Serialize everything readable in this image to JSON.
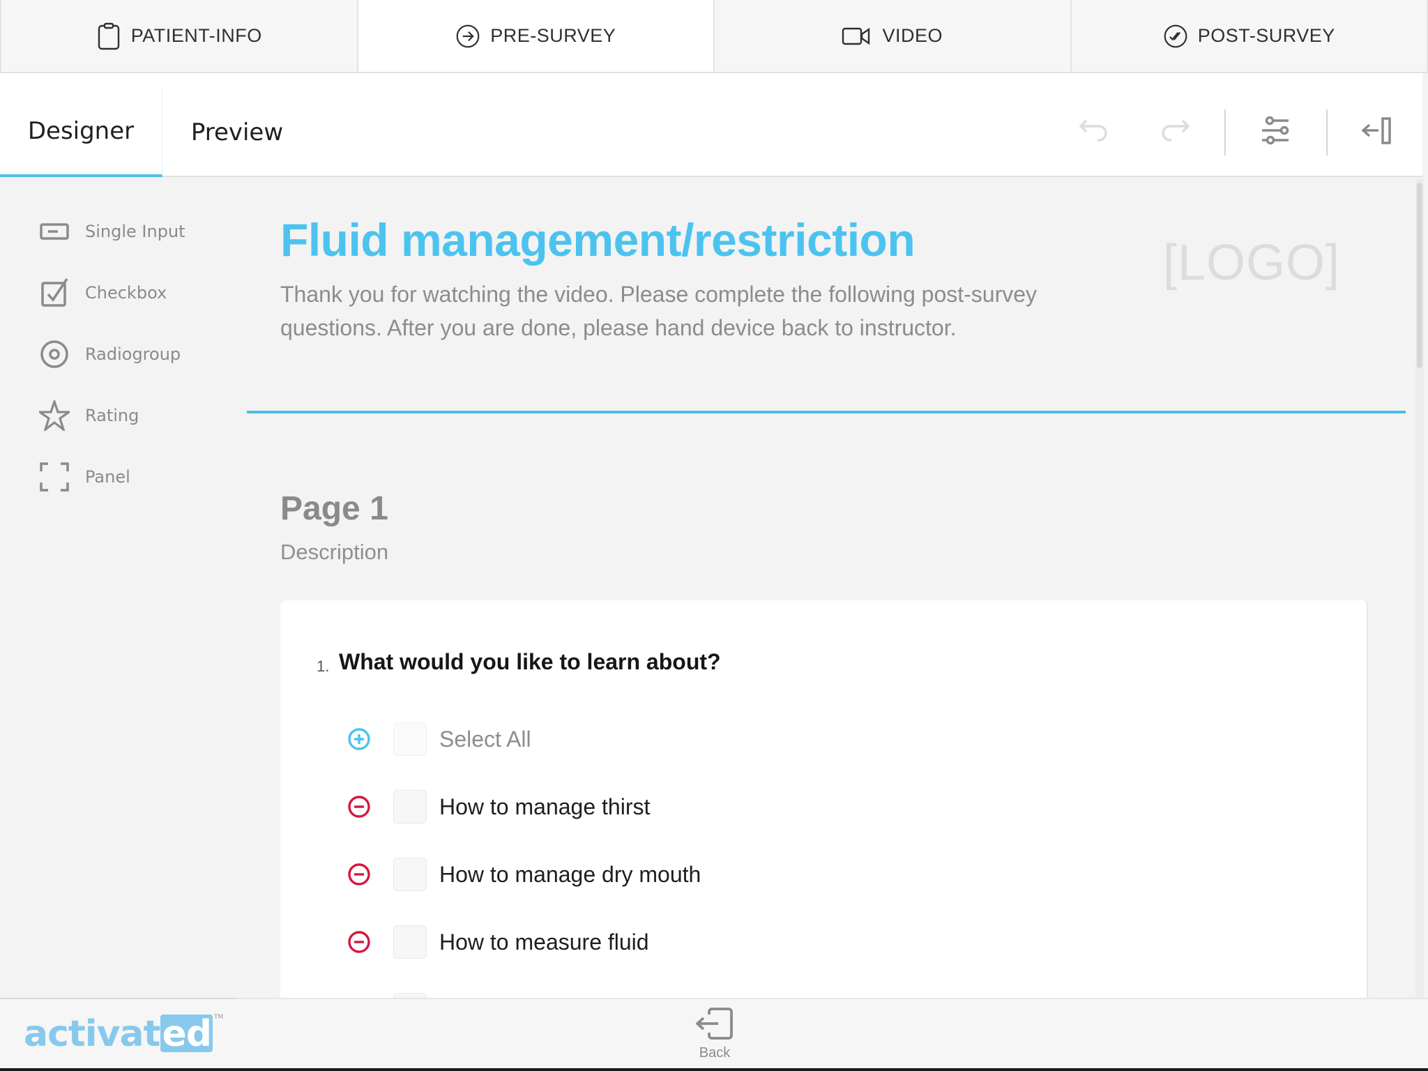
{
  "steps": [
    {
      "label": "PATIENT-INFO",
      "icon": "clipboard-icon",
      "active": false
    },
    {
      "label": "PRE-SURVEY",
      "icon": "arrow-circle-right-icon",
      "active": true
    },
    {
      "label": "VIDEO",
      "icon": "video-camera-icon",
      "active": false
    },
    {
      "label": "POST-SURVEY",
      "icon": "double-check-circle-icon",
      "active": false
    }
  ],
  "toolbar": {
    "tabs": [
      {
        "label": "Designer",
        "active": true
      },
      {
        "label": "Preview",
        "active": false
      }
    ],
    "actions": [
      "undo-icon",
      "redo-icon",
      "settings-sliders-icon",
      "collapse-panel-icon"
    ]
  },
  "palette": {
    "items": [
      {
        "label": "Single Input",
        "icon": "single-input-icon"
      },
      {
        "label": "Checkbox",
        "icon": "checkbox-icon"
      },
      {
        "label": "Radiogroup",
        "icon": "radiogroup-icon"
      },
      {
        "label": "Rating",
        "icon": "star-icon"
      },
      {
        "label": "Panel",
        "icon": "panel-icon"
      }
    ]
  },
  "survey": {
    "title": "Fluid management/restriction",
    "description": "Thank you for watching the video. Please complete the following post-survey questions. After you are done, please hand device back to instructor.",
    "logo_placeholder": "[LOGO]",
    "page": {
      "title": "Page 1",
      "description": "Description"
    },
    "question": {
      "number": "1.",
      "title": "What would you like to learn about?",
      "select_all_label": "Select All",
      "choices": [
        "How to manage thirst",
        "How to manage dry mouth",
        "How to measure fluid"
      ]
    }
  },
  "footer": {
    "brand_main": "activat",
    "brand_badge": "ed",
    "brand_tm": "TM",
    "back_label": "Back"
  },
  "colors": {
    "accent": "#4cc3ef",
    "remove": "#d6173f",
    "brand": "#87c9ec"
  }
}
